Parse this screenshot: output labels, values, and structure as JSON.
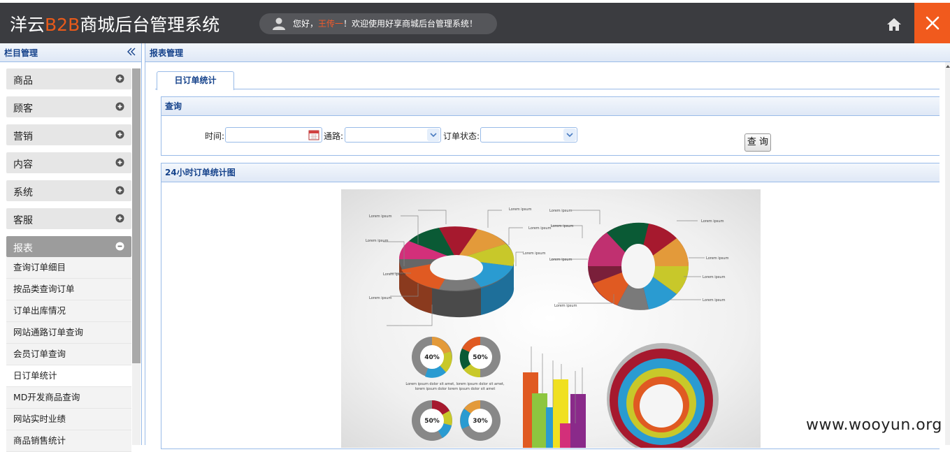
{
  "header": {
    "brand_prefix": "洋云",
    "brand_accent": "B2B",
    "brand_suffix": "商城后台管理系统",
    "welcome_prefix": "您好，",
    "user_name": "王传一",
    "welcome_suffix": "！欢迎使用好享商城后台管理系统！",
    "home_icon": "home-icon",
    "close_icon": "close-icon"
  },
  "sidebar": {
    "title": "栏目管理",
    "menus": [
      {
        "label": "商品",
        "state": "collapsed"
      },
      {
        "label": "顾客",
        "state": "collapsed"
      },
      {
        "label": "营销",
        "state": "collapsed"
      },
      {
        "label": "内容",
        "state": "collapsed"
      },
      {
        "label": "系统",
        "state": "collapsed"
      },
      {
        "label": "客服",
        "state": "collapsed"
      },
      {
        "label": "报表",
        "state": "expanded"
      }
    ],
    "report_items": [
      "查询订单细目",
      "按品类查询订单",
      "订单出库情况",
      "网站通路订单查询",
      "会员订单查询",
      "日订单统计",
      "MD开发商品查询",
      "网站实时业绩",
      "商品销售统计"
    ],
    "current_item": "日订单统计"
  },
  "main": {
    "title": "报表管理",
    "tab_label": "日订单统计",
    "query": {
      "header": "查询",
      "time_label": "时间:",
      "time_value": "",
      "channel_label": "通路:",
      "channel_value": "",
      "status_label": "订单状态:",
      "status_value": "",
      "button_label": "查 询"
    },
    "chart": {
      "header": "24小时订单统计图",
      "pct_labels": [
        "40%",
        "50%",
        "50%",
        "30%"
      ],
      "lorem": "Lorem ipsum",
      "lorem_long_1": "Lorem ipsum dolor sit amet, lorem ipsum dolor sit amet,",
      "lorem_long_2": "lorem ipsum dolor lorem ipsum dolor sit amet"
    }
  },
  "watermark": "www.wooyun.org",
  "colors": {
    "header_bg": "#3b3c40",
    "accent_orange": "#e85a1a",
    "close_bg": "#f15a1d",
    "panel_title": "#15428b",
    "panel_border": "#99bbe8"
  }
}
